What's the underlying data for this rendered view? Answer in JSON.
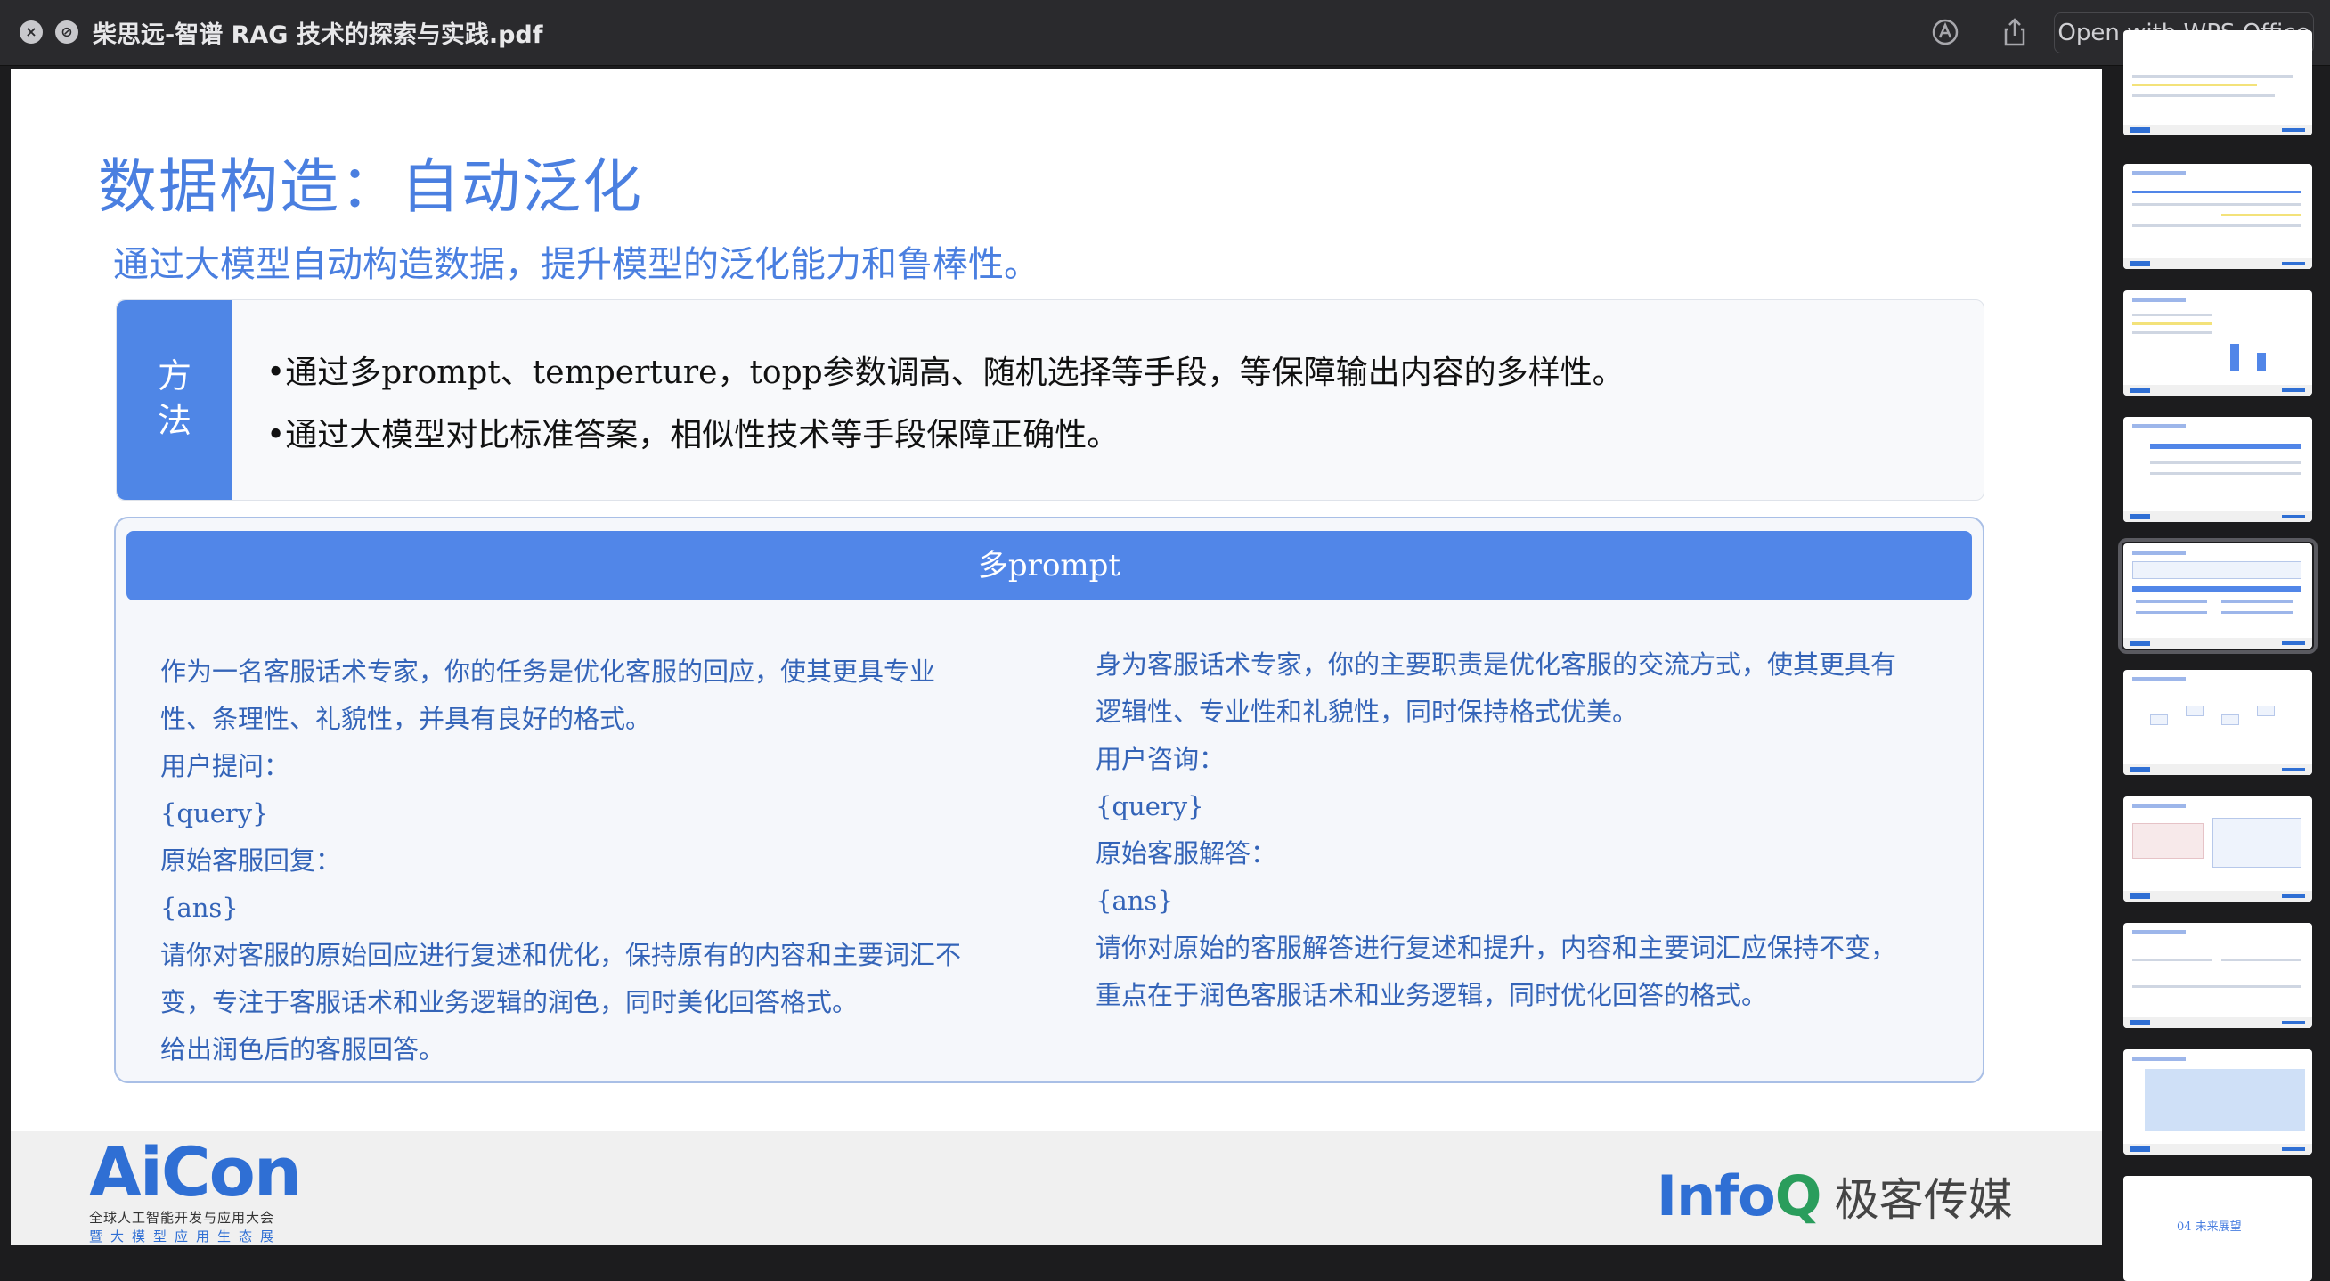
{
  "window": {
    "title": "柴思远-智谱 RAG 技术的探索与实践.pdf",
    "open_with_label": "Open with WPS Office",
    "icons": [
      "close-icon",
      "pin-icon",
      "markup-icon",
      "share-icon"
    ]
  },
  "slide": {
    "title": "数据构造：自动泛化",
    "subtitle": "通过大模型自动构造数据，提升模型的泛化能力和鲁棒性。",
    "method": {
      "tag": "方 法",
      "bullets": [
        "•通过多prompt、temperture，topp参数调高、随机选择等手段，等保障输出内容的多样性。",
        "•通过大模型对比标准答案，相似性技术等手段保障正确性。"
      ]
    },
    "prompt_section": {
      "header": "多prompt",
      "left": [
        "作为一名客服话术专家，你的任务是优化客服的回应，使其更具专业",
        "性、条理性、礼貌性，并具有良好的格式。",
        "用户提问：",
        "{query}",
        "原始客服回复：",
        "{ans}",
        "请你对客服的原始回应进行复述和优化，保持原有的内容和主要词汇不",
        "变，专注于客服话术和业务逻辑的润色，同时美化回答格式。",
        "给出润色后的客服回答。"
      ],
      "right": [
        "身为客服话术专家，你的主要职责是优化客服的交流方式，使其更具有",
        "逻辑性、专业性和礼貌性，同时保持格式优美。",
        "用户咨询：",
        "{query}",
        "原始客服解答：",
        "{ans}",
        "请你对原始的客服解答进行复述和提升，内容和主要词汇应保持不变，",
        "重点在于润色客服话术和业务逻辑，同时优化回答的格式。"
      ]
    },
    "footer": {
      "aicon_logo": "AiCon",
      "aicon_sub1": "全球人工智能开发与应用大会",
      "aicon_sub2": "暨大模型应用生态展",
      "infoq_info": "Info",
      "infoq_q": "Q",
      "infoq_cn": "极客传媒"
    }
  },
  "thumbnails": {
    "last_thumb_text": "04 未来展望",
    "selected_index": 4
  },
  "colors": {
    "accent": "#4a7fe0",
    "header_blue": "#5186e8",
    "prompt_text": "#3464b8"
  }
}
